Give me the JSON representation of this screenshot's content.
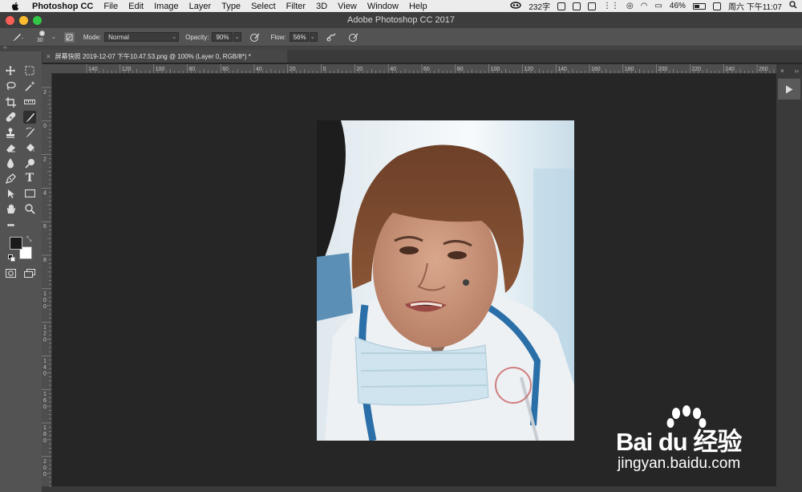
{
  "menubar": {
    "app_name": "Photoshop CC",
    "items": [
      "File",
      "Edit",
      "Image",
      "Layer",
      "Type",
      "Select",
      "Filter",
      "3D",
      "View",
      "Window",
      "Help"
    ],
    "status": {
      "char_count": "232字",
      "battery": "46%",
      "clock": "周六 下午11:07"
    }
  },
  "window": {
    "title": "Adobe Photoshop CC 2017"
  },
  "options": {
    "brush_size": "30",
    "mode_label": "Mode:",
    "mode_value": "Normal",
    "opacity_label": "Opacity:",
    "opacity_value": "90%",
    "flow_label": "Flow:",
    "flow_value": "56%"
  },
  "document": {
    "tab_title": "屏幕快照 2019-12-07 下午10.47.53.png @ 100% (Layer 0, RGB/8*) *"
  },
  "rulers": {
    "horizontal_ticks": [
      "140",
      "120",
      "100",
      "80",
      "60",
      "40",
      "20",
      "0",
      "20",
      "40",
      "60",
      "80",
      "100",
      "120",
      "140",
      "160",
      "180",
      "200",
      "220",
      "240",
      "260"
    ],
    "vertical_ticks": [
      "2",
      "0",
      "2",
      "4",
      "6",
      "8",
      "1 0 0",
      "1 2 0",
      "1 4 0",
      "1 6 0",
      "1 8 0",
      "2 0 0"
    ]
  },
  "watermark": {
    "brand": "Bai du 经验",
    "url": "jingyan.baidu.com"
  },
  "colors": {
    "foreground": "#1a1a1a",
    "background": "#ffffff",
    "accent_red": "#fc5f57",
    "accent_yellow": "#fdbc2e",
    "accent_green": "#33c748"
  }
}
